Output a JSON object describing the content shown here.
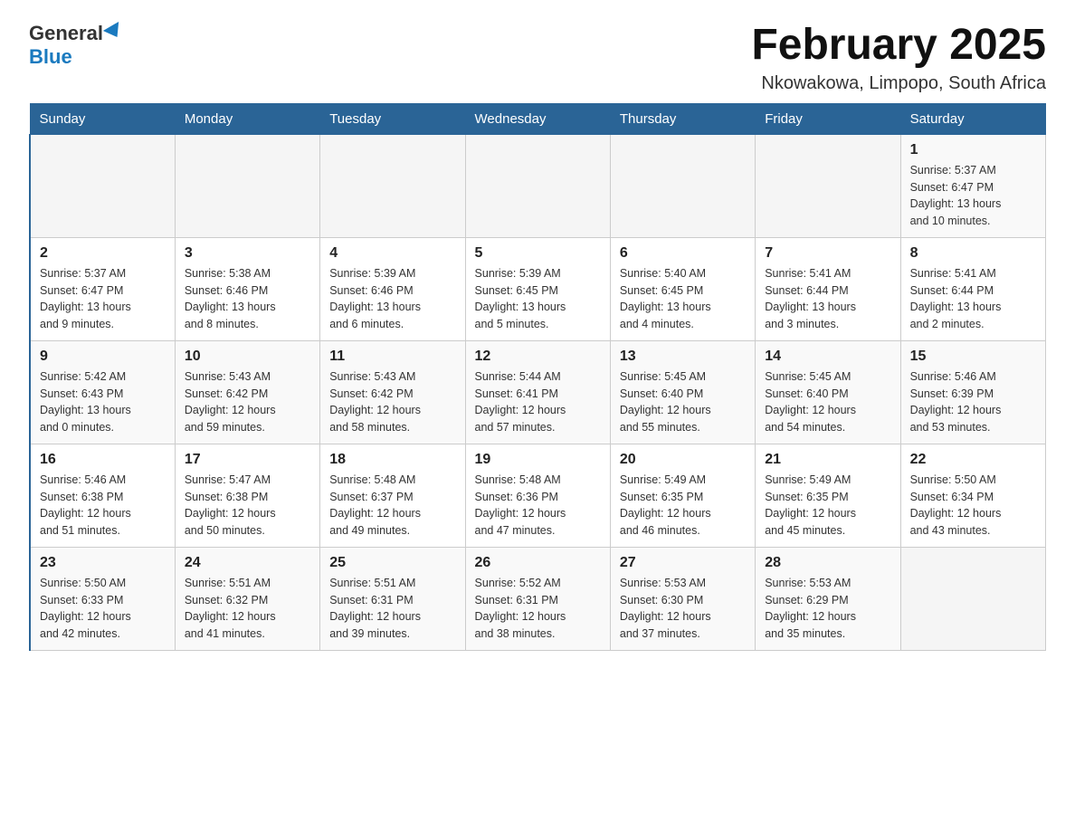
{
  "logo": {
    "general": "General",
    "blue": "Blue"
  },
  "title": "February 2025",
  "subtitle": "Nkowakowa, Limpopo, South Africa",
  "days_header": [
    "Sunday",
    "Monday",
    "Tuesday",
    "Wednesday",
    "Thursday",
    "Friday",
    "Saturday"
  ],
  "weeks": [
    [
      {
        "day": "",
        "info": ""
      },
      {
        "day": "",
        "info": ""
      },
      {
        "day": "",
        "info": ""
      },
      {
        "day": "",
        "info": ""
      },
      {
        "day": "",
        "info": ""
      },
      {
        "day": "",
        "info": ""
      },
      {
        "day": "1",
        "info": "Sunrise: 5:37 AM\nSunset: 6:47 PM\nDaylight: 13 hours\nand 10 minutes."
      }
    ],
    [
      {
        "day": "2",
        "info": "Sunrise: 5:37 AM\nSunset: 6:47 PM\nDaylight: 13 hours\nand 9 minutes."
      },
      {
        "day": "3",
        "info": "Sunrise: 5:38 AM\nSunset: 6:46 PM\nDaylight: 13 hours\nand 8 minutes."
      },
      {
        "day": "4",
        "info": "Sunrise: 5:39 AM\nSunset: 6:46 PM\nDaylight: 13 hours\nand 6 minutes."
      },
      {
        "day": "5",
        "info": "Sunrise: 5:39 AM\nSunset: 6:45 PM\nDaylight: 13 hours\nand 5 minutes."
      },
      {
        "day": "6",
        "info": "Sunrise: 5:40 AM\nSunset: 6:45 PM\nDaylight: 13 hours\nand 4 minutes."
      },
      {
        "day": "7",
        "info": "Sunrise: 5:41 AM\nSunset: 6:44 PM\nDaylight: 13 hours\nand 3 minutes."
      },
      {
        "day": "8",
        "info": "Sunrise: 5:41 AM\nSunset: 6:44 PM\nDaylight: 13 hours\nand 2 minutes."
      }
    ],
    [
      {
        "day": "9",
        "info": "Sunrise: 5:42 AM\nSunset: 6:43 PM\nDaylight: 13 hours\nand 0 minutes."
      },
      {
        "day": "10",
        "info": "Sunrise: 5:43 AM\nSunset: 6:42 PM\nDaylight: 12 hours\nand 59 minutes."
      },
      {
        "day": "11",
        "info": "Sunrise: 5:43 AM\nSunset: 6:42 PM\nDaylight: 12 hours\nand 58 minutes."
      },
      {
        "day": "12",
        "info": "Sunrise: 5:44 AM\nSunset: 6:41 PM\nDaylight: 12 hours\nand 57 minutes."
      },
      {
        "day": "13",
        "info": "Sunrise: 5:45 AM\nSunset: 6:40 PM\nDaylight: 12 hours\nand 55 minutes."
      },
      {
        "day": "14",
        "info": "Sunrise: 5:45 AM\nSunset: 6:40 PM\nDaylight: 12 hours\nand 54 minutes."
      },
      {
        "day": "15",
        "info": "Sunrise: 5:46 AM\nSunset: 6:39 PM\nDaylight: 12 hours\nand 53 minutes."
      }
    ],
    [
      {
        "day": "16",
        "info": "Sunrise: 5:46 AM\nSunset: 6:38 PM\nDaylight: 12 hours\nand 51 minutes."
      },
      {
        "day": "17",
        "info": "Sunrise: 5:47 AM\nSunset: 6:38 PM\nDaylight: 12 hours\nand 50 minutes."
      },
      {
        "day": "18",
        "info": "Sunrise: 5:48 AM\nSunset: 6:37 PM\nDaylight: 12 hours\nand 49 minutes."
      },
      {
        "day": "19",
        "info": "Sunrise: 5:48 AM\nSunset: 6:36 PM\nDaylight: 12 hours\nand 47 minutes."
      },
      {
        "day": "20",
        "info": "Sunrise: 5:49 AM\nSunset: 6:35 PM\nDaylight: 12 hours\nand 46 minutes."
      },
      {
        "day": "21",
        "info": "Sunrise: 5:49 AM\nSunset: 6:35 PM\nDaylight: 12 hours\nand 45 minutes."
      },
      {
        "day": "22",
        "info": "Sunrise: 5:50 AM\nSunset: 6:34 PM\nDaylight: 12 hours\nand 43 minutes."
      }
    ],
    [
      {
        "day": "23",
        "info": "Sunrise: 5:50 AM\nSunset: 6:33 PM\nDaylight: 12 hours\nand 42 minutes."
      },
      {
        "day": "24",
        "info": "Sunrise: 5:51 AM\nSunset: 6:32 PM\nDaylight: 12 hours\nand 41 minutes."
      },
      {
        "day": "25",
        "info": "Sunrise: 5:51 AM\nSunset: 6:31 PM\nDaylight: 12 hours\nand 39 minutes."
      },
      {
        "day": "26",
        "info": "Sunrise: 5:52 AM\nSunset: 6:31 PM\nDaylight: 12 hours\nand 38 minutes."
      },
      {
        "day": "27",
        "info": "Sunrise: 5:53 AM\nSunset: 6:30 PM\nDaylight: 12 hours\nand 37 minutes."
      },
      {
        "day": "28",
        "info": "Sunrise: 5:53 AM\nSunset: 6:29 PM\nDaylight: 12 hours\nand 35 minutes."
      },
      {
        "day": "",
        "info": ""
      }
    ]
  ]
}
